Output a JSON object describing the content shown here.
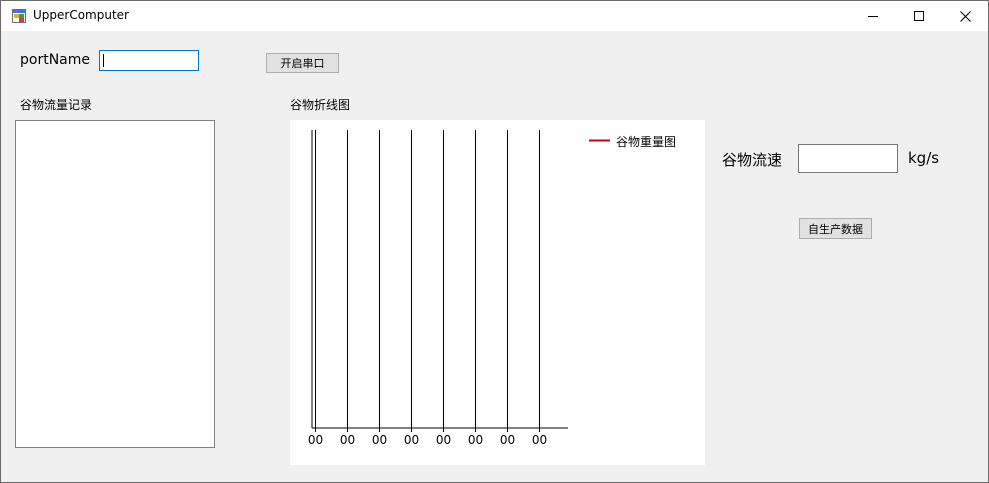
{
  "window": {
    "title": "UpperComputer",
    "icon": "form-icon",
    "controls": [
      "minimize-icon",
      "maximize-icon",
      "close-icon"
    ]
  },
  "serial": {
    "port_label": "portName",
    "port_value": "",
    "open_button": "开启串口"
  },
  "record": {
    "label": "谷物流量记录",
    "items": []
  },
  "chart": {
    "label": "谷物折线图",
    "legend": "谷物重量图",
    "legend_color": "#cc0000"
  },
  "flow": {
    "label": "谷物流速",
    "value": "",
    "unit": "kg/s",
    "generate_button": "自生产数据"
  },
  "chart_data": {
    "type": "line",
    "series": [
      {
        "name": "谷物重量图",
        "values": [],
        "color": "#cc0000"
      }
    ],
    "x_tick_labels": [
      "00",
      "00",
      "00",
      "00",
      "00",
      "00",
      "00",
      "00"
    ],
    "grid": "vertical",
    "legend_position": "top-right"
  }
}
